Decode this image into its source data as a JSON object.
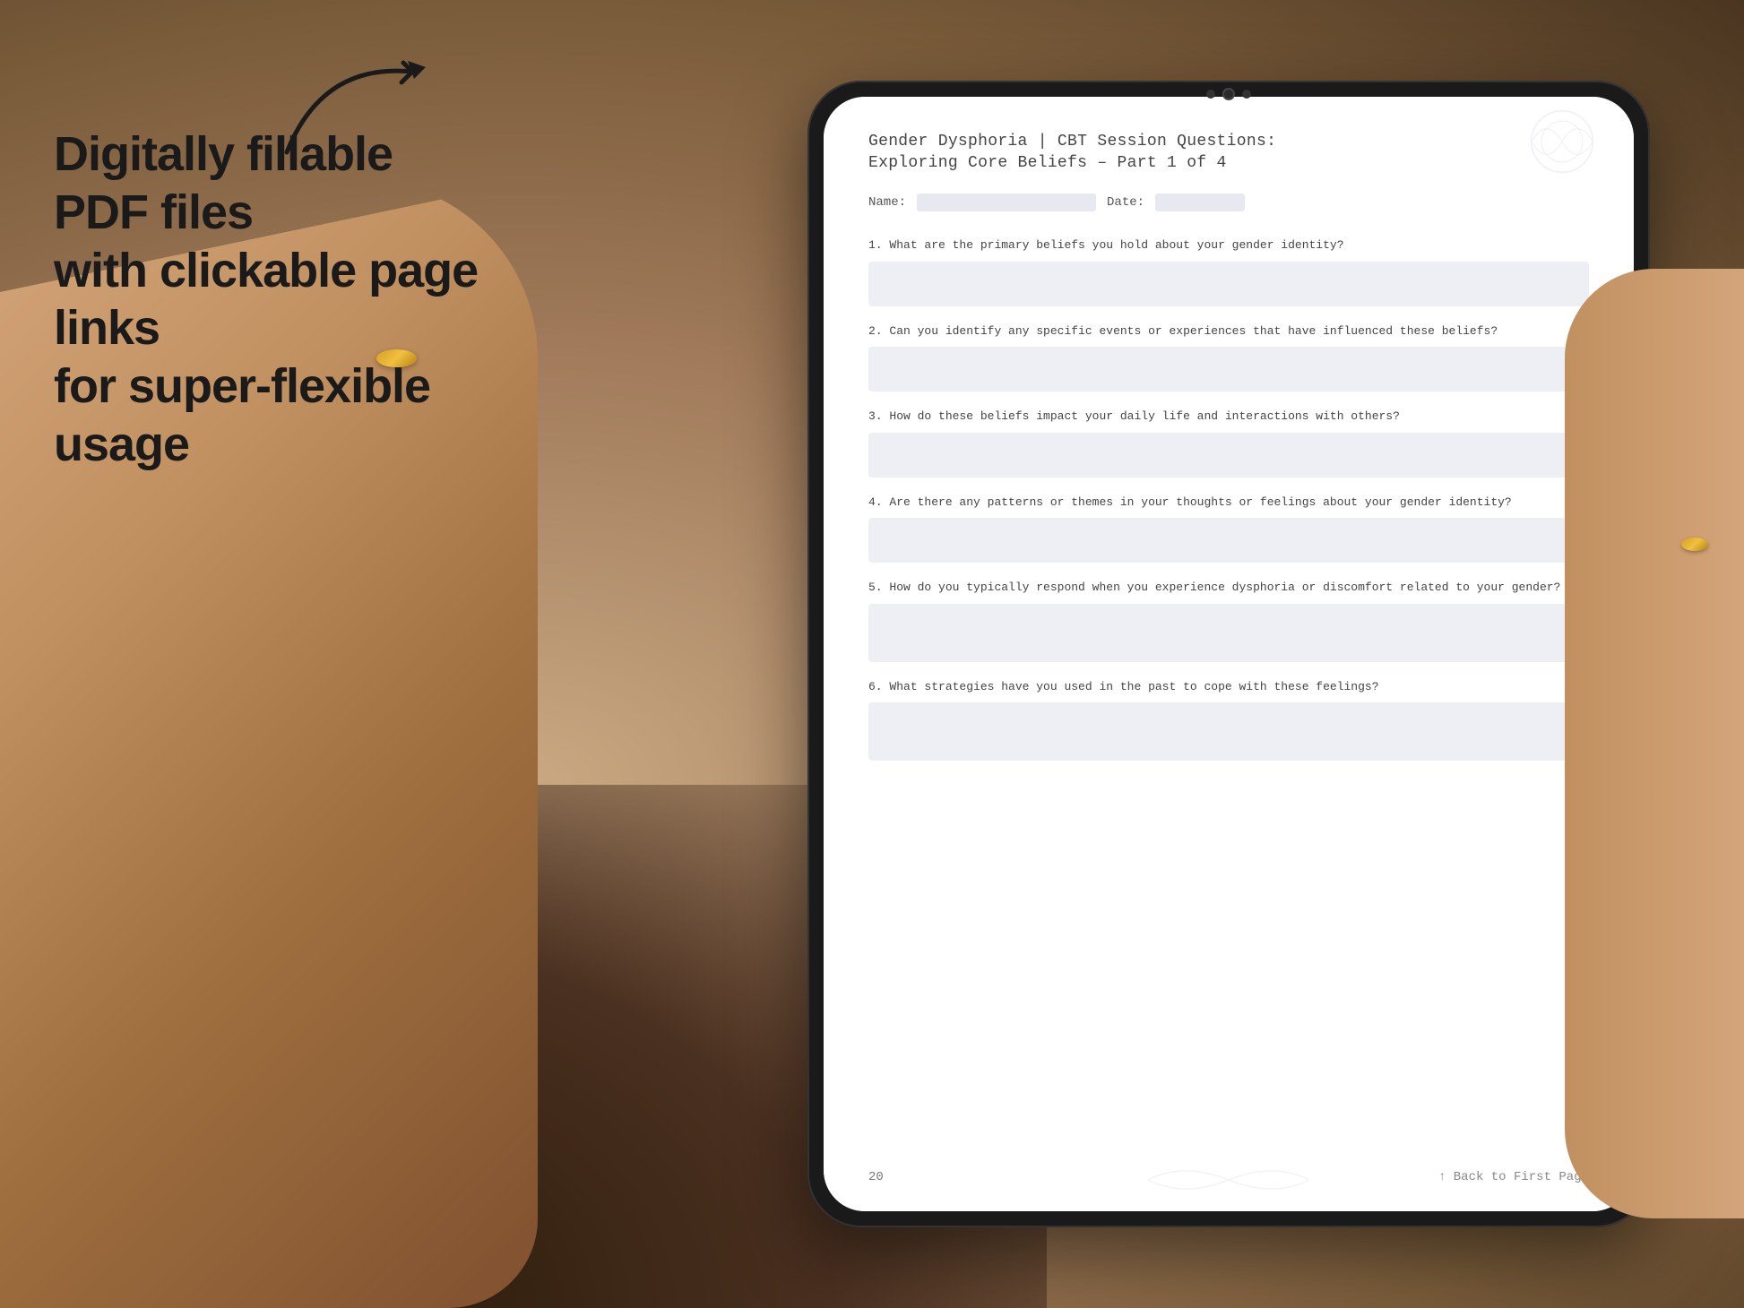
{
  "background": {
    "color_main": "#b8977a",
    "color_dark": "#3a2510"
  },
  "left_text": {
    "line1": "Digitally fillable PDF files",
    "line2": "with clickable page links",
    "line3": "for super-flexible usage"
  },
  "arrow": {
    "label": "arrow pointing right"
  },
  "tablet": {
    "pdf": {
      "title_main": "Gender Dysphoria | CBT Session Questions:",
      "title_sub": "Exploring Core Beliefs  – Part 1 of 4",
      "name_label": "Name:",
      "date_label": "Date:",
      "questions": [
        {
          "number": "1.",
          "text": "What are the primary beliefs you hold about your gender identity?"
        },
        {
          "number": "2.",
          "text": "Can you identify any specific events or experiences that have influenced these beliefs?"
        },
        {
          "number": "3.",
          "text": "How do these beliefs impact your daily life and interactions with others?"
        },
        {
          "number": "4.",
          "text": "Are there any patterns or themes in your thoughts or feelings about your gender identity?"
        },
        {
          "number": "5.",
          "text": "How do you typically respond when you experience dysphoria or discomfort related to your gender?"
        },
        {
          "number": "6.",
          "text": "What strategies have you used in the past to cope with these feelings?"
        }
      ],
      "footer": {
        "page_number": "20",
        "back_link": "↑ Back to First Page"
      }
    }
  }
}
